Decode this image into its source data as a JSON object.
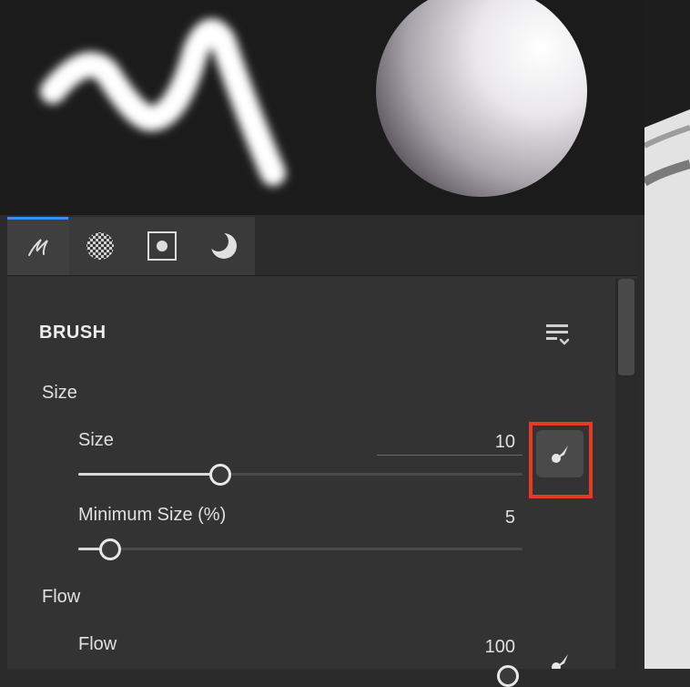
{
  "panel": {
    "tabs": [
      {
        "name": "brush-tab",
        "icon": "brush-stroke-icon",
        "active": true
      },
      {
        "name": "texture-tab",
        "icon": "checkerboard-icon",
        "active": false
      },
      {
        "name": "mask-tab",
        "icon": "square-dot-icon",
        "active": false
      },
      {
        "name": "shape-tab",
        "icon": "moon-icon",
        "active": false
      }
    ],
    "section_title": "BRUSH",
    "groups": [
      {
        "label": "Size",
        "params": [
          {
            "label": "Size",
            "value": "10",
            "slider_fraction": 0.31,
            "pressure_toggle": true
          },
          {
            "label": "Minimum Size (%)",
            "value": "5",
            "slider_fraction": 0.05
          }
        ]
      },
      {
        "label": "Flow",
        "params": [
          {
            "label": "Flow",
            "value": "100",
            "pressure_toggle": true
          }
        ]
      }
    ]
  }
}
